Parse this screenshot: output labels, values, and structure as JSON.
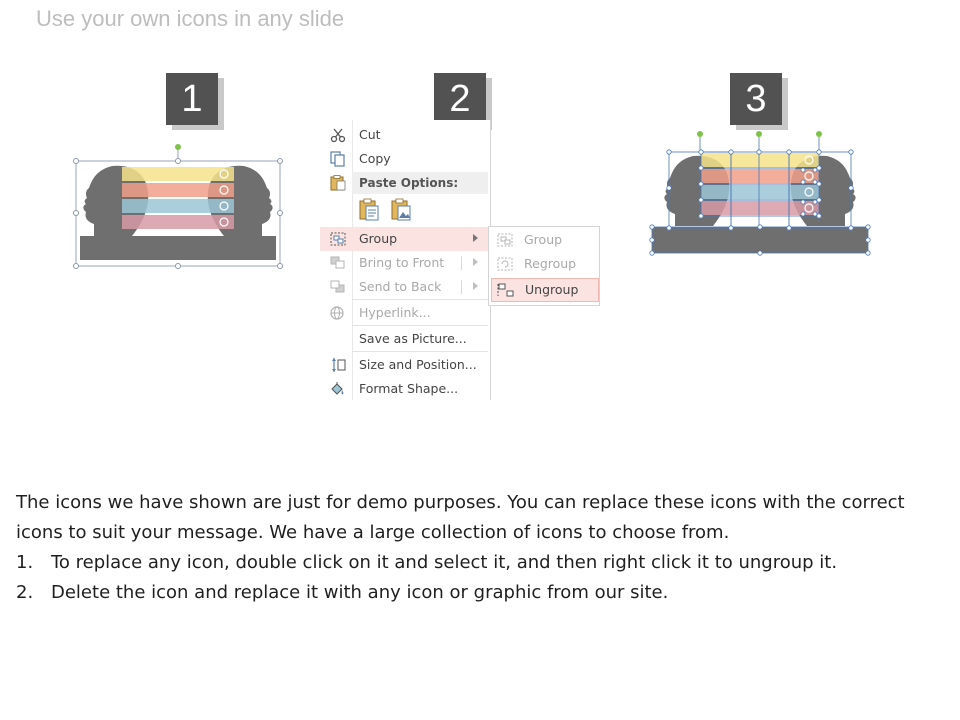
{
  "slide": {
    "title": "Use your own icons in any slide"
  },
  "steps": [
    "1",
    "2",
    "3"
  ],
  "colors": {
    "band_yellow": "#f6e38b",
    "band_orange": "#f0a08a",
    "band_blue": "#9cc5d6",
    "band_pink": "#d79aa4",
    "silhouette": "#6f6f6f",
    "badge": "#525252",
    "handle_green": "#7fc24a",
    "selection_blue": "#4a78b5",
    "menu_highlight": "#fbe3e1"
  },
  "context_menu": {
    "cut": "Cut",
    "copy": "Copy",
    "paste_options": "Paste Options:",
    "group": "Group",
    "bring_to_front": "Bring to Front",
    "send_to_back": "Send to Back",
    "hyperlink": "Hyperlink...",
    "save_as_picture": "Save as Picture...",
    "size_and_position": "Size and Position...",
    "format_shape": "Format Shape...",
    "submenu": {
      "group": "Group",
      "regroup": "Regroup",
      "ungroup": "Ungroup"
    }
  },
  "instructions": {
    "intro": "The icons we have shown are just for demo purposes. You can replace these icons with the correct icons to suit your message. We have a large collection of icons to choose from.",
    "items": [
      {
        "num": "1.",
        "text": "To replace any icon, double click on it and select it, and then right click it to ungroup it."
      },
      {
        "num": "2.",
        "text": "Delete the icon and replace it with any icon or graphic from our site."
      }
    ]
  }
}
